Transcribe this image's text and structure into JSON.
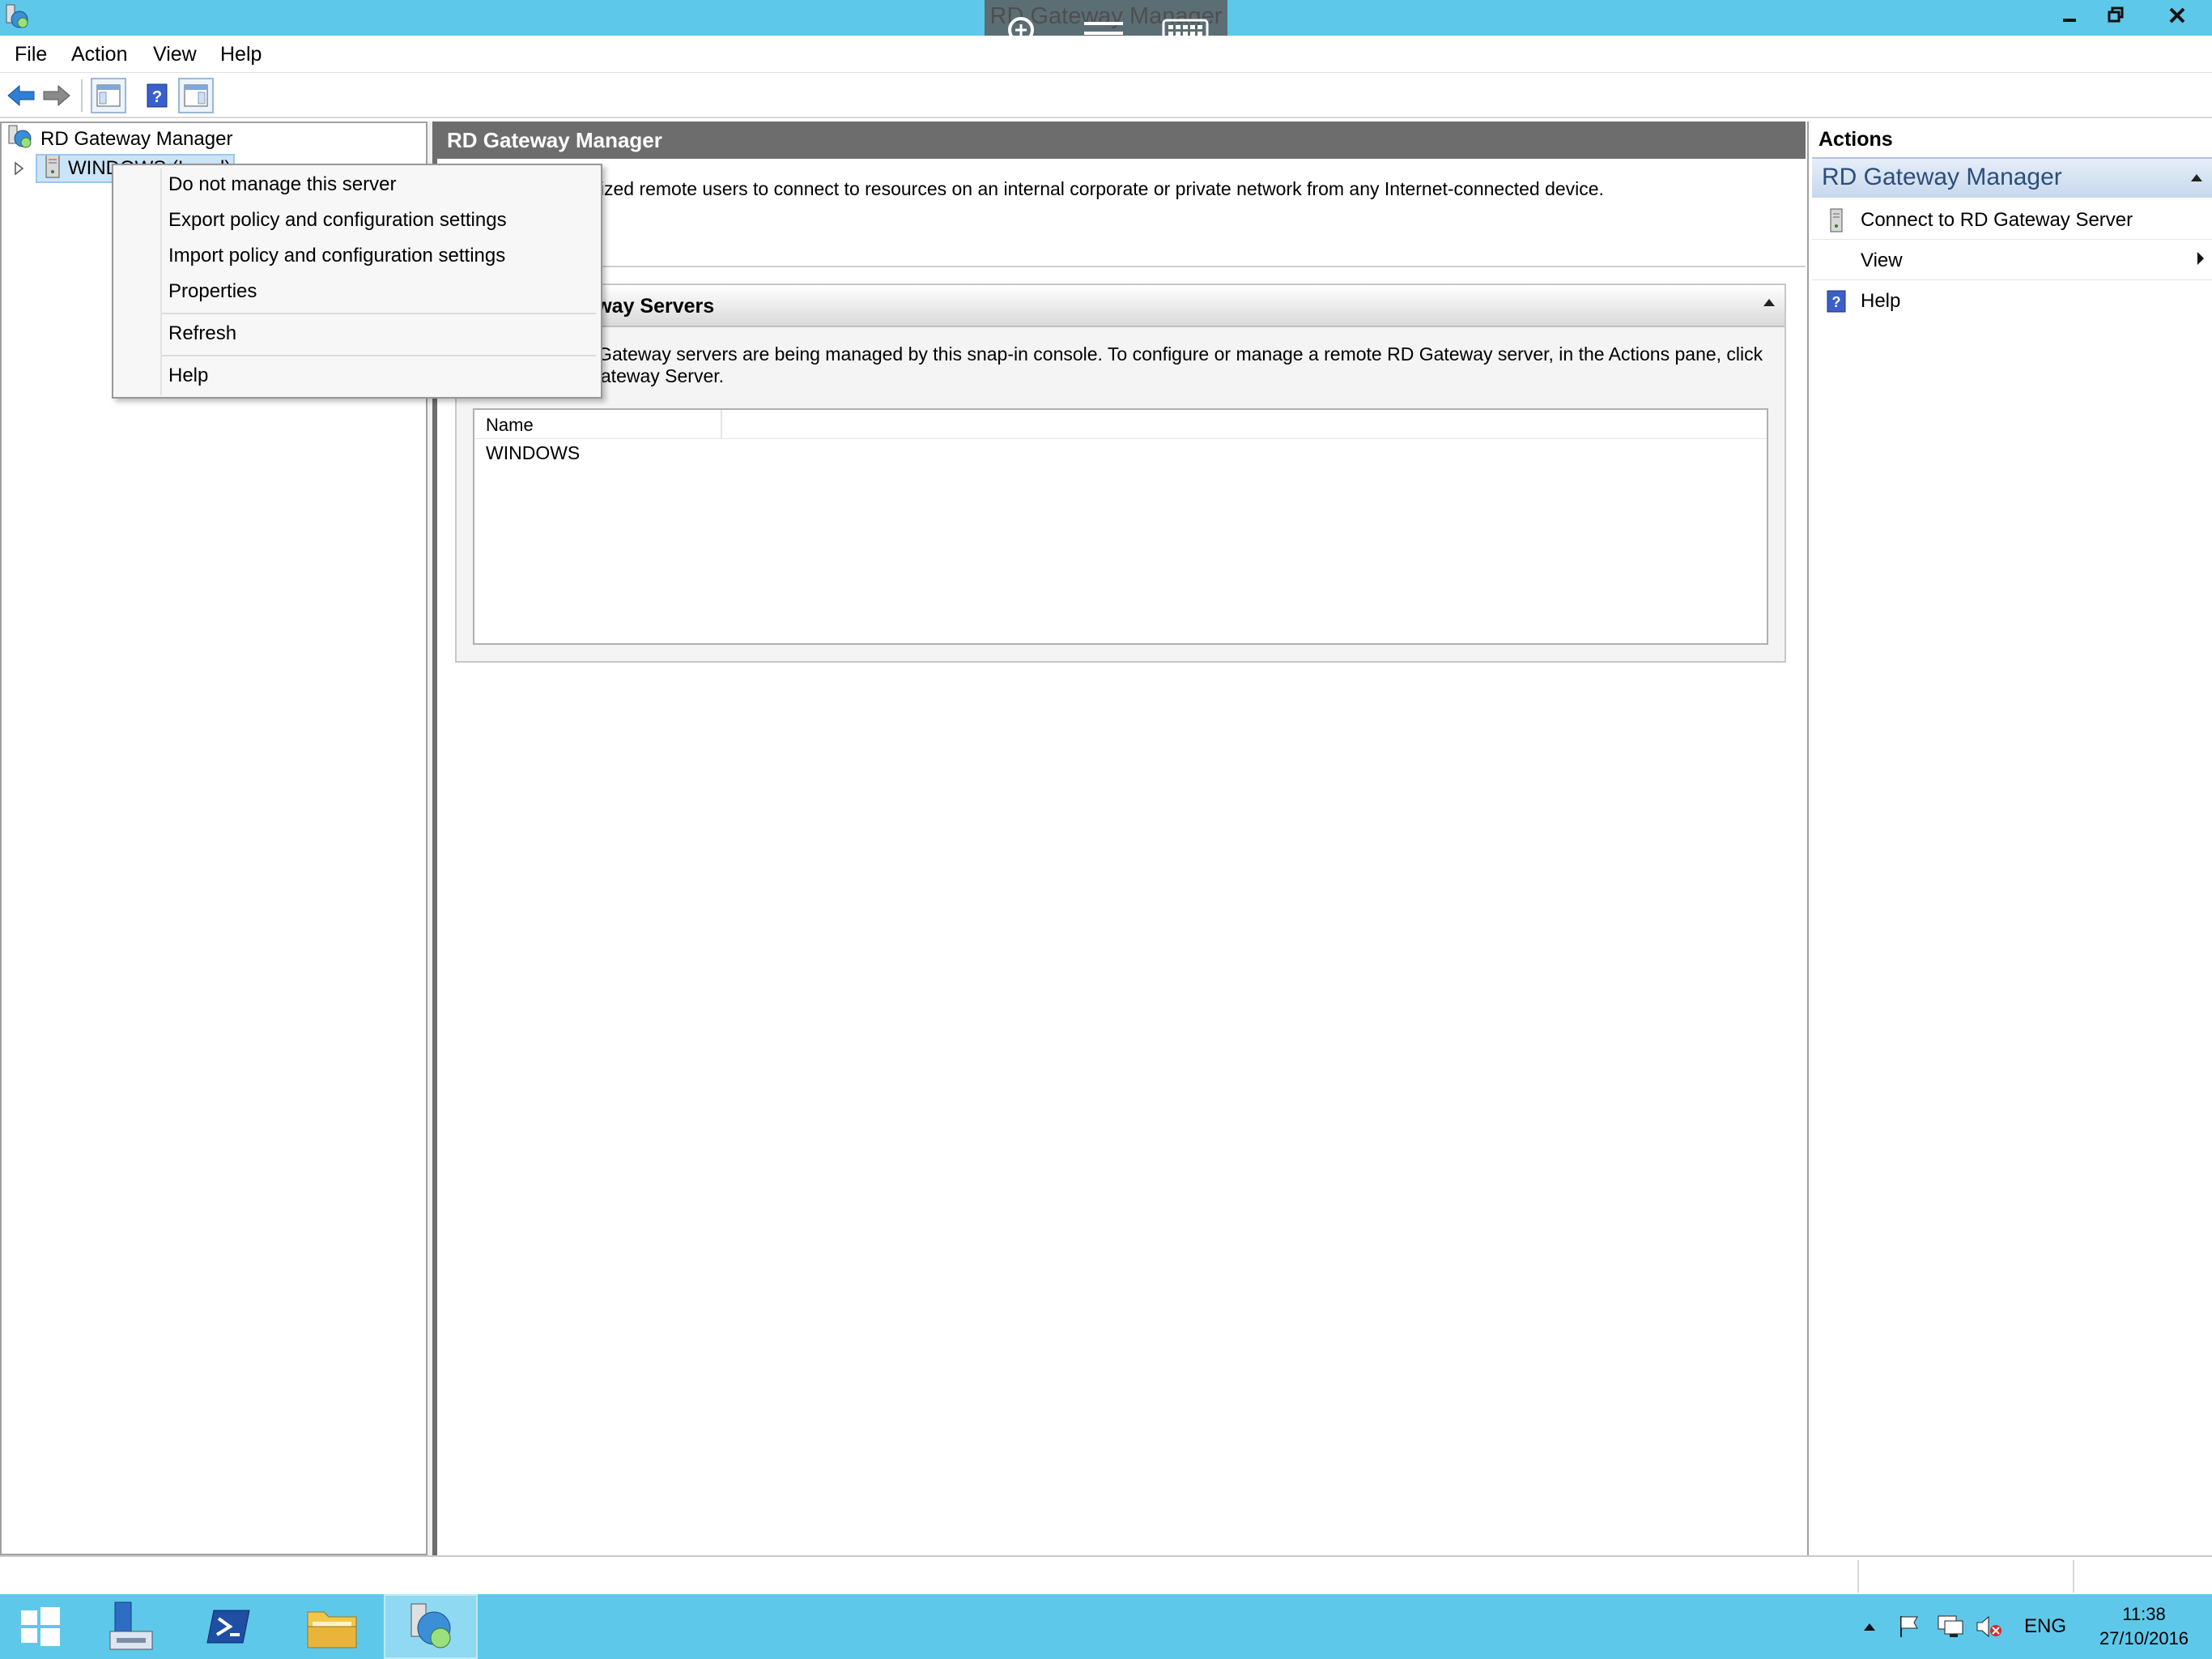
{
  "window": {
    "title": "RD Gateway Manager",
    "controls": {
      "minimize": "minimize",
      "maximize": "restore",
      "close": "close"
    }
  },
  "menu": [
    "File",
    "Action",
    "View",
    "Help"
  ],
  "tree": {
    "root": "RD Gateway Manager",
    "server": "WINDOWS (Local)"
  },
  "context_menu": {
    "items": [
      "Do not manage this server",
      "Export policy and configuration settings",
      "Import policy and configuration settings",
      "Properties",
      "Refresh",
      "Help"
    ]
  },
  "center": {
    "header": "RD Gateway Manager",
    "description": "ay enables authorized remote users to connect to resources on an internal corporate or private network from any Internet-connected device.",
    "section": {
      "title": "teway Servers",
      "text_line1": ") Gateway servers are being managed by this snap-in console. To configure or manage a remote RD Gateway server, in the Actions pane, click",
      "text_line2": "Gateway Server.",
      "column_name": "Name",
      "rows": [
        "WINDOWS"
      ]
    }
  },
  "actions": {
    "title": "Actions",
    "group": "RD Gateway Manager",
    "items": {
      "connect": "Connect to RD Gateway Server",
      "view": "View",
      "help": "Help"
    }
  },
  "taskbar": {
    "language": "ENG",
    "time": "11:38",
    "date": "27/10/2016"
  },
  "colors": {
    "titlebar": "#5ec8ea",
    "pane_header": "#6d6d6d",
    "actions_group_text": "#2b4e7a"
  }
}
